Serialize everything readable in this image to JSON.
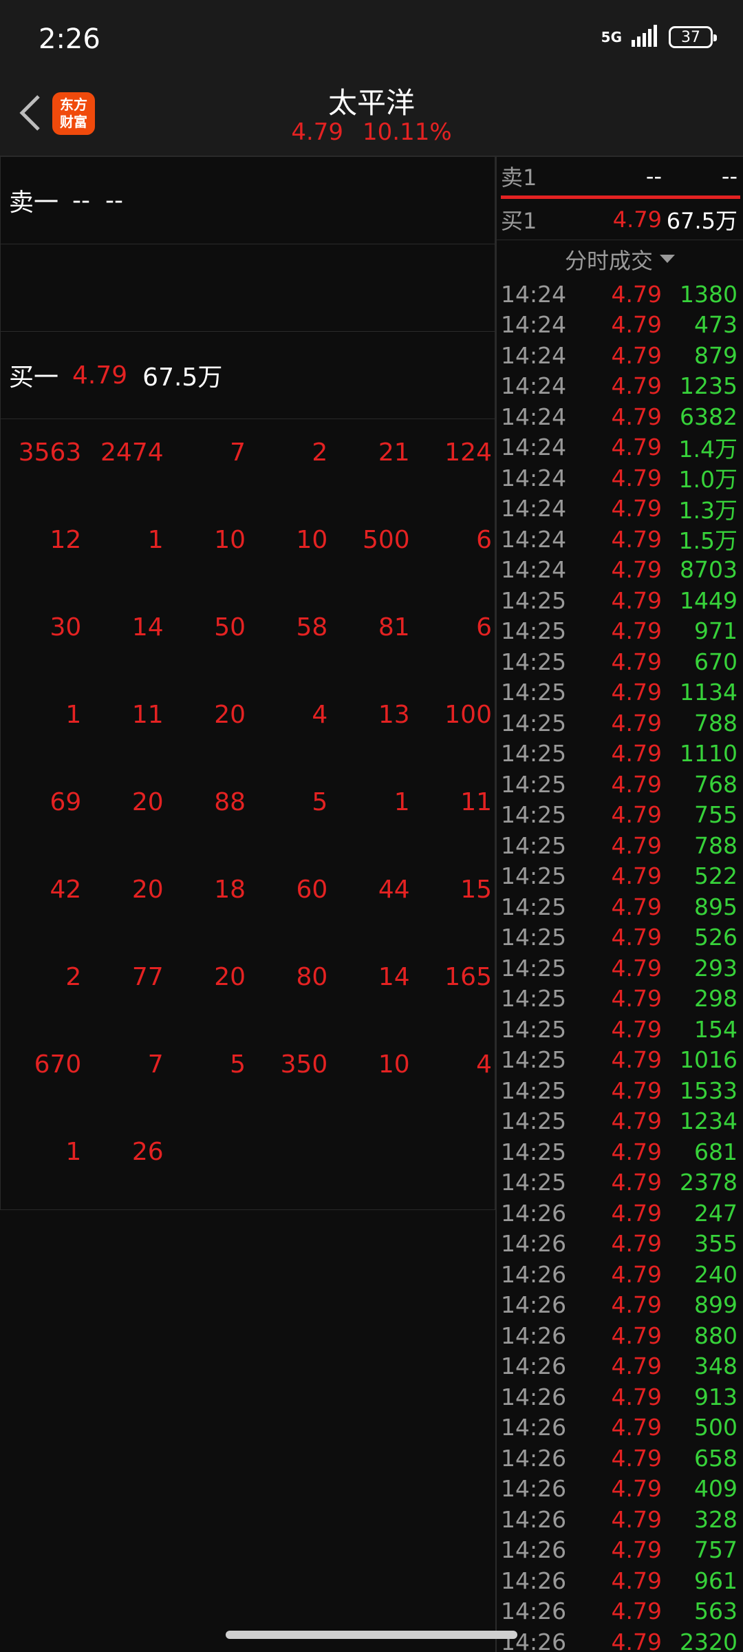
{
  "status_bar": {
    "time": "2:26",
    "network": "5G",
    "battery": "37"
  },
  "header": {
    "title": "太平洋",
    "price": "4.79",
    "change_pct": "10.11%",
    "logo_line1": "东方",
    "logo_line2": "财富"
  },
  "order_book": {
    "sell1": {
      "label": "卖一",
      "price": "--",
      "volume": "--"
    },
    "buy1": {
      "label": "买一",
      "price": "4.79",
      "volume": "67.5万"
    }
  },
  "queue": [
    "3563",
    "2474",
    "7",
    "2",
    "21",
    "124",
    "12",
    "1",
    "10",
    "10",
    "500",
    "6",
    "30",
    "14",
    "50",
    "58",
    "81",
    "6",
    "1",
    "11",
    "20",
    "4",
    "13",
    "100",
    "69",
    "20",
    "88",
    "5",
    "1",
    "11",
    "42",
    "20",
    "18",
    "60",
    "44",
    "15",
    "2",
    "77",
    "20",
    "80",
    "14",
    "165",
    "670",
    "7",
    "5",
    "350",
    "10",
    "4",
    "1",
    "26"
  ],
  "right_panel": {
    "sell1": {
      "label": "卖1",
      "price": "--",
      "volume": "--"
    },
    "buy1": {
      "label": "买1",
      "price": "4.79",
      "volume": "67.5万"
    },
    "trades_title": "分时成交",
    "trades": [
      {
        "time": "14:24",
        "price": "4.79",
        "volume": "1380"
      },
      {
        "time": "14:24",
        "price": "4.79",
        "volume": "473"
      },
      {
        "time": "14:24",
        "price": "4.79",
        "volume": "879"
      },
      {
        "time": "14:24",
        "price": "4.79",
        "volume": "1235"
      },
      {
        "time": "14:24",
        "price": "4.79",
        "volume": "6382"
      },
      {
        "time": "14:24",
        "price": "4.79",
        "volume": "1.4万"
      },
      {
        "time": "14:24",
        "price": "4.79",
        "volume": "1.0万"
      },
      {
        "time": "14:24",
        "price": "4.79",
        "volume": "1.3万"
      },
      {
        "time": "14:24",
        "price": "4.79",
        "volume": "1.5万"
      },
      {
        "time": "14:24",
        "price": "4.79",
        "volume": "8703"
      },
      {
        "time": "14:25",
        "price": "4.79",
        "volume": "1449"
      },
      {
        "time": "14:25",
        "price": "4.79",
        "volume": "971"
      },
      {
        "time": "14:25",
        "price": "4.79",
        "volume": "670"
      },
      {
        "time": "14:25",
        "price": "4.79",
        "volume": "1134"
      },
      {
        "time": "14:25",
        "price": "4.79",
        "volume": "788"
      },
      {
        "time": "14:25",
        "price": "4.79",
        "volume": "1110"
      },
      {
        "time": "14:25",
        "price": "4.79",
        "volume": "768"
      },
      {
        "time": "14:25",
        "price": "4.79",
        "volume": "755"
      },
      {
        "time": "14:25",
        "price": "4.79",
        "volume": "788"
      },
      {
        "time": "14:25",
        "price": "4.79",
        "volume": "522"
      },
      {
        "time": "14:25",
        "price": "4.79",
        "volume": "895"
      },
      {
        "time": "14:25",
        "price": "4.79",
        "volume": "526"
      },
      {
        "time": "14:25",
        "price": "4.79",
        "volume": "293"
      },
      {
        "time": "14:25",
        "price": "4.79",
        "volume": "298"
      },
      {
        "time": "14:25",
        "price": "4.79",
        "volume": "154"
      },
      {
        "time": "14:25",
        "price": "4.79",
        "volume": "1016"
      },
      {
        "time": "14:25",
        "price": "4.79",
        "volume": "1533"
      },
      {
        "time": "14:25",
        "price": "4.79",
        "volume": "1234"
      },
      {
        "time": "14:25",
        "price": "4.79",
        "volume": "681"
      },
      {
        "time": "14:25",
        "price": "4.79",
        "volume": "2378"
      },
      {
        "time": "14:26",
        "price": "4.79",
        "volume": "247"
      },
      {
        "time": "14:26",
        "price": "4.79",
        "volume": "355"
      },
      {
        "time": "14:26",
        "price": "4.79",
        "volume": "240"
      },
      {
        "time": "14:26",
        "price": "4.79",
        "volume": "899"
      },
      {
        "time": "14:26",
        "price": "4.79",
        "volume": "880"
      },
      {
        "time": "14:26",
        "price": "4.79",
        "volume": "348"
      },
      {
        "time": "14:26",
        "price": "4.79",
        "volume": "913"
      },
      {
        "time": "14:26",
        "price": "4.79",
        "volume": "500"
      },
      {
        "time": "14:26",
        "price": "4.79",
        "volume": "658"
      },
      {
        "time": "14:26",
        "price": "4.79",
        "volume": "409"
      },
      {
        "time": "14:26",
        "price": "4.79",
        "volume": "328"
      },
      {
        "time": "14:26",
        "price": "4.79",
        "volume": "757"
      },
      {
        "time": "14:26",
        "price": "4.79",
        "volume": "961"
      },
      {
        "time": "14:26",
        "price": "4.79",
        "volume": "563"
      },
      {
        "time": "14:26",
        "price": "4.79",
        "volume": "2320"
      }
    ]
  },
  "colors": {
    "up": "#e42222",
    "down_volume": "#37d23a",
    "muted": "#9a9a9a",
    "brand": "#f04a0c"
  },
  "icons": {
    "back": "chevron-left-icon",
    "signal": "signal-bars-icon",
    "battery": "battery-icon",
    "dropdown": "caret-down-icon"
  }
}
